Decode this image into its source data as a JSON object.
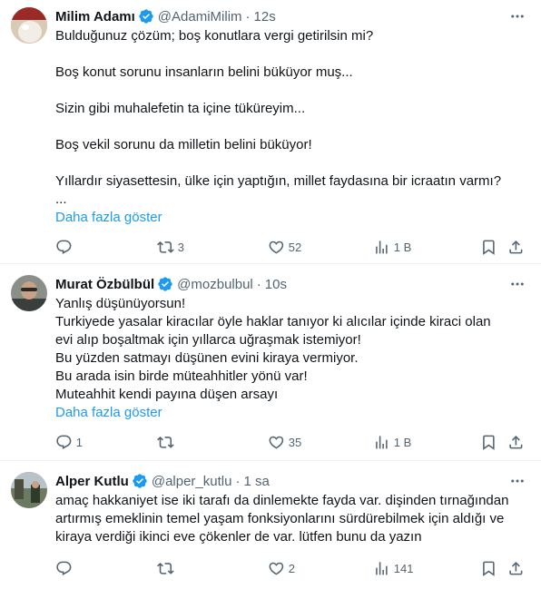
{
  "tweets": [
    {
      "name": "Milim Adamı",
      "handle": "@AdamiMilim",
      "dot": "·",
      "time": "12s",
      "lines": [
        "Bulduğunuz çözüm; boş konutlara vergi getirilsin mi?",
        "",
        "Boş konut sorunu insanların belini büküyor muş...",
        "",
        "Sizin gibi muhalefetin ta içine tüküreyim...",
        "",
        "Boş vekil sorunu da milletin belini büküyor!",
        "",
        "Yıllardır siyasettesin, ülke için yaptığın, millet faydasına bir icraatın varmı?",
        "..."
      ],
      "show_more": "Daha fazla göster",
      "replies": "",
      "retweets": "3",
      "likes": "52",
      "views": "1 B"
    },
    {
      "name": "Murat Özbülbül",
      "handle": "@mozbulbul",
      "dot": "·",
      "time": "10s",
      "lines": [
        "Yanlış düşünüyorsun!",
        "Turkiyede yasalar kiracılar öyle haklar tanıyor ki alıcılar içinde kiraci olan evi alıp boşaltmak için yıllarca uğraşmak istemiyor!",
        "Bu yüzden satmayı düşünen evini kiraya vermiyor.",
        "Bu arada isin birde müteahhitler yönü var!",
        "Muteahhit kendi payına düşen arsayı"
      ],
      "show_more": "Daha fazla göster",
      "replies": "1",
      "retweets": "",
      "likes": "35",
      "views": "1 B"
    },
    {
      "name": "Alper Kutlu",
      "handle": "@alper_kutlu",
      "dot": "·",
      "time": "1 sa",
      "lines": [
        "amaç hakkaniyet ise iki tarafı da dinlemekte fayda var. dişinden tırnağından artırmış emeklinin temel yaşam fonksiyonlarını sürdürebilmek için aldığı ve kiraya verdiği ikinci eve çökenler de var. lütfen bunu da yazın"
      ],
      "show_more": "",
      "replies": "",
      "retweets": "",
      "likes": "2",
      "views": "141"
    }
  ],
  "colors": {
    "text": "#0f1419",
    "secondary": "#536471",
    "link": "#1d9bf0",
    "verified": "#1d9bf0",
    "divider": "#eff3f4"
  },
  "icons": [
    "reply-icon",
    "retweet-icon",
    "like-icon",
    "views-icon",
    "bookmark-icon",
    "share-icon",
    "more-icon",
    "verified-badge-icon"
  ]
}
